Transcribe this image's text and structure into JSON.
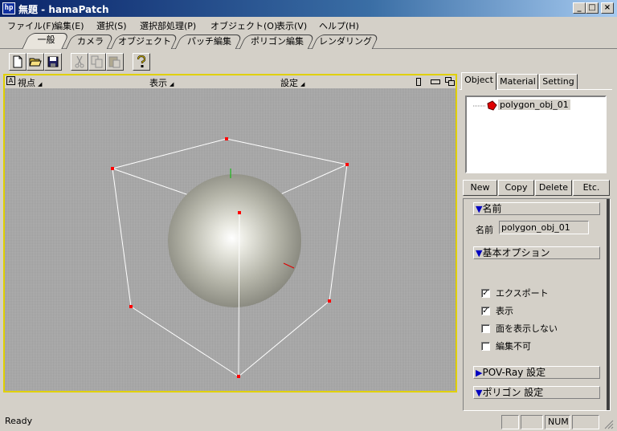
{
  "window": {
    "icon_text": "hp",
    "title": "無題 - hamaPatch",
    "minimize": "_",
    "maximize": "□",
    "close": "×"
  },
  "menu": [
    "ファイル(F)",
    "編集(E)",
    "選択(S)",
    "選択部処理(P)",
    "オブジェクト(O)",
    "表示(V)",
    "ヘルプ(H)"
  ],
  "top_tabs": [
    {
      "label": "一般",
      "active": true
    },
    {
      "label": "カメラ",
      "active": false
    },
    {
      "label": "オブジェクト",
      "active": false
    },
    {
      "label": "パッチ編集",
      "active": false
    },
    {
      "label": "ポリゴン編集",
      "active": false
    },
    {
      "label": "レンダリング",
      "active": false
    }
  ],
  "toolbar": {
    "new_icon": "new-file-icon",
    "open_icon": "open-folder-icon",
    "save_icon": "save-disk-icon",
    "cut_icon": "scissors-icon",
    "copy_icon": "copy-icon",
    "paste_icon": "paste-icon",
    "help_icon": "help-question-icon"
  },
  "viewport": {
    "corner": "A",
    "menu_viewpoint": "視点",
    "menu_display": "表示",
    "menu_settings": "設定",
    "border_color": "#e0d000",
    "background": "#a9a9a9"
  },
  "right_panel": {
    "tabs": [
      {
        "label": "Object",
        "active": true
      },
      {
        "label": "Material",
        "active": false
      },
      {
        "label": "Setting",
        "active": false
      }
    ],
    "tree_item": "polygon_obj_01",
    "buttons": {
      "new": "New",
      "copy": "Copy",
      "delete": "Delete",
      "etc": "Etc."
    },
    "section_name": "名前",
    "name_label": "名前",
    "name_value": "polygon_obj_01",
    "section_basic": "基本オプション",
    "checkboxes": [
      {
        "label": "エクスポート",
        "checked": true
      },
      {
        "label": "表示",
        "checked": true
      },
      {
        "label": "面を表示しない",
        "checked": false
      },
      {
        "label": "編集不可",
        "checked": false
      }
    ],
    "section_povray": "POV-Ray 設定",
    "section_polygon": "ポリゴン  設定"
  },
  "status": {
    "text": "Ready",
    "num": "NUM"
  }
}
